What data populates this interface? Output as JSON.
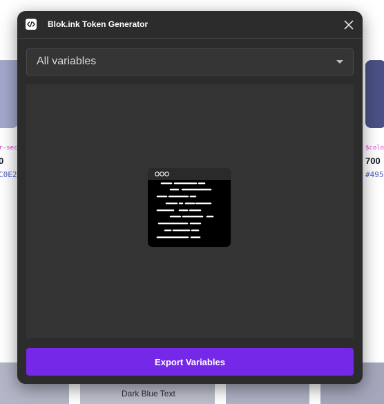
{
  "background": {
    "left_card": {
      "token_name": "or-sec",
      "weight": "0",
      "hex": "C0E2"
    },
    "right_card": {
      "token_name": "$color",
      "weight": "700",
      "hex": "#495"
    },
    "bottom_label": "Dark Blue Text"
  },
  "modal": {
    "title": "Blok.ink Token Generator",
    "app_icon": "code-icon",
    "close_icon": "close-icon",
    "dropdown": {
      "selected": "All variables"
    },
    "preview_icon": "code-window-icon",
    "export_label": "Export Variables"
  },
  "colors": {
    "modal_bg": "#2c2c2c",
    "accent": "#7628e8",
    "token_name": "#d63cd6",
    "token_hex": "#4a5cc0"
  }
}
